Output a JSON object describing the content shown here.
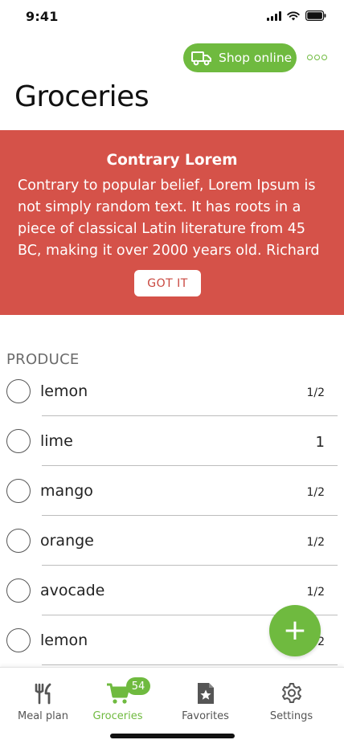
{
  "status_bar": {
    "time": "9:41"
  },
  "header": {
    "shop_label": "Shop online",
    "title": "Groceries"
  },
  "banner": {
    "title": "Contrary  Lorem",
    "text": "Contrary to popular belief, Lorem Ipsum is not simply random text. It has roots in a piece of classical Latin literature from 45 BC, making it over 2000 years old. Richard",
    "button_label": "GOT IT"
  },
  "list": {
    "section_title": "PRODUCE",
    "items": [
      {
        "name": "lemon",
        "qty": "1/2"
      },
      {
        "name": "lime",
        "qty": "1"
      },
      {
        "name": "mango",
        "qty": "1/2"
      },
      {
        "name": "orange",
        "qty": "1/2"
      },
      {
        "name": "avocade",
        "qty": "1/2"
      },
      {
        "name": "lemon",
        "qty": "1/2"
      }
    ]
  },
  "fab": {
    "label": "+"
  },
  "tabs": [
    {
      "label": "Meal plan",
      "icon": "fork-knife-icon"
    },
    {
      "label": "Groceries",
      "icon": "cart-icon",
      "badge": "54"
    },
    {
      "label": "Favorites",
      "icon": "favorite-doc-icon"
    },
    {
      "label": "Settings",
      "icon": "gear-icon"
    }
  ],
  "colors": {
    "accent": "#6fba3f",
    "banner": "#d55249",
    "text": "#222222"
  }
}
